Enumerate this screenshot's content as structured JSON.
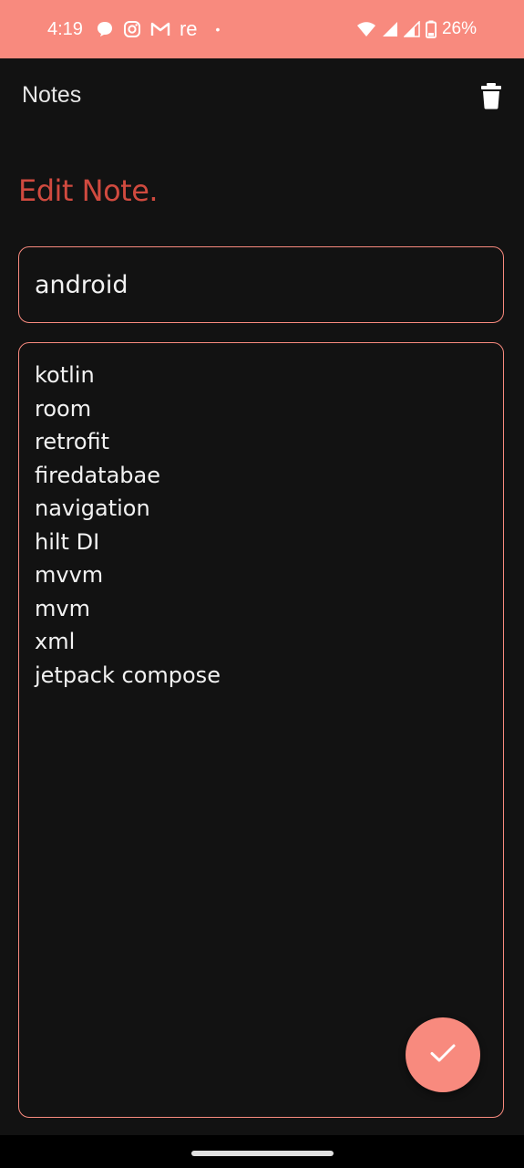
{
  "status_bar": {
    "time": "4:19",
    "carrier_text": "re",
    "dot": "•",
    "battery": "26%",
    "background": "#F88A7E",
    "icons": [
      "chat-bubble-icon",
      "instagram-icon",
      "gmail-icon",
      "wifi-icon",
      "signal-icon",
      "signal-icon",
      "battery-icon"
    ]
  },
  "app_bar": {
    "title": "Notes",
    "delete_icon": "trash-icon"
  },
  "editor": {
    "heading": "Edit Note.",
    "title_value": "android",
    "body_value": "kotlin\nroom\nretrofit\nfiredatabae\nnavigation\nhilt DI\nmvvm\nmvm\nxml\njetpack compose"
  },
  "fab": {
    "icon": "check-icon",
    "color": "#F88A7E"
  },
  "colors": {
    "background": "#121212",
    "accent": "#F88A7E",
    "heading": "#D04A3F",
    "text": "#F2F2F2"
  }
}
